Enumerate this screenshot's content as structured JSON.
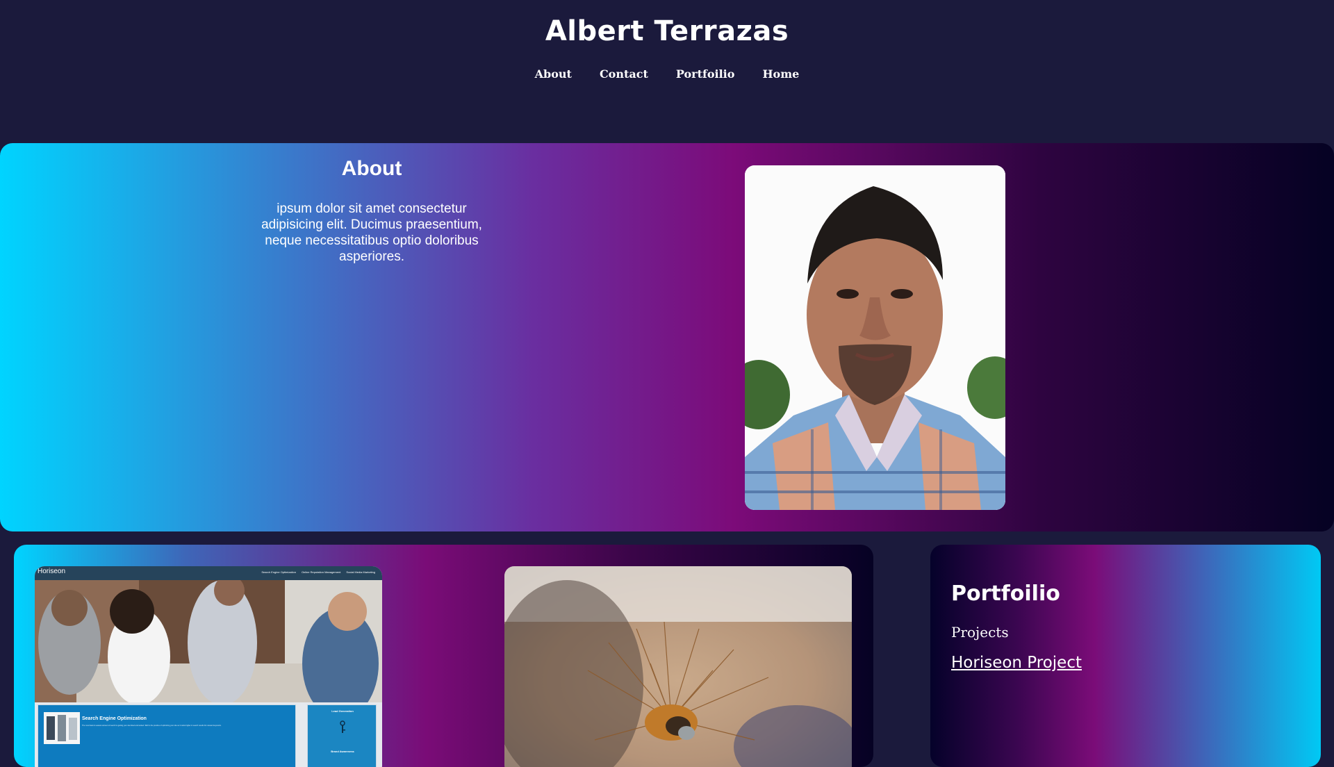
{
  "header": {
    "title": "Albert Terrazas",
    "nav": [
      "About",
      "Contact",
      "Portfoilio",
      "Home"
    ]
  },
  "about": {
    "heading": "About",
    "text": "ipsum dolor sit amet consectetur adipisicing elit. Ducimus praesentium, neque necessitatibus optio doloribus asperiores."
  },
  "projects": {
    "horiseon_preview": {
      "logo": "Horiseon",
      "nav_links": [
        "Search Engine Optimization",
        "Online Reputation Management",
        "Social Media Marketing"
      ],
      "feature_title": "Search Engine Optimization",
      "feature_text": "The most basic & easiest element of search is getting your site listed and ranked. SEO is the practice of optimizing your site so it ranks higher in search results for relevant keywords.",
      "sidebar_title": "Lead Generation",
      "sidebar_title2": "Brand Awareness"
    }
  },
  "portfolio": {
    "title": "Portfoilio",
    "subtitle": "Projects",
    "link_text": "Horiseon Project"
  },
  "colors": {
    "page_background": "#1b1a3c",
    "gradient_cyan": "#00d4ff",
    "gradient_magenta": "#7c0b79",
    "gradient_dark": "#050223",
    "text": "#ffffff"
  }
}
